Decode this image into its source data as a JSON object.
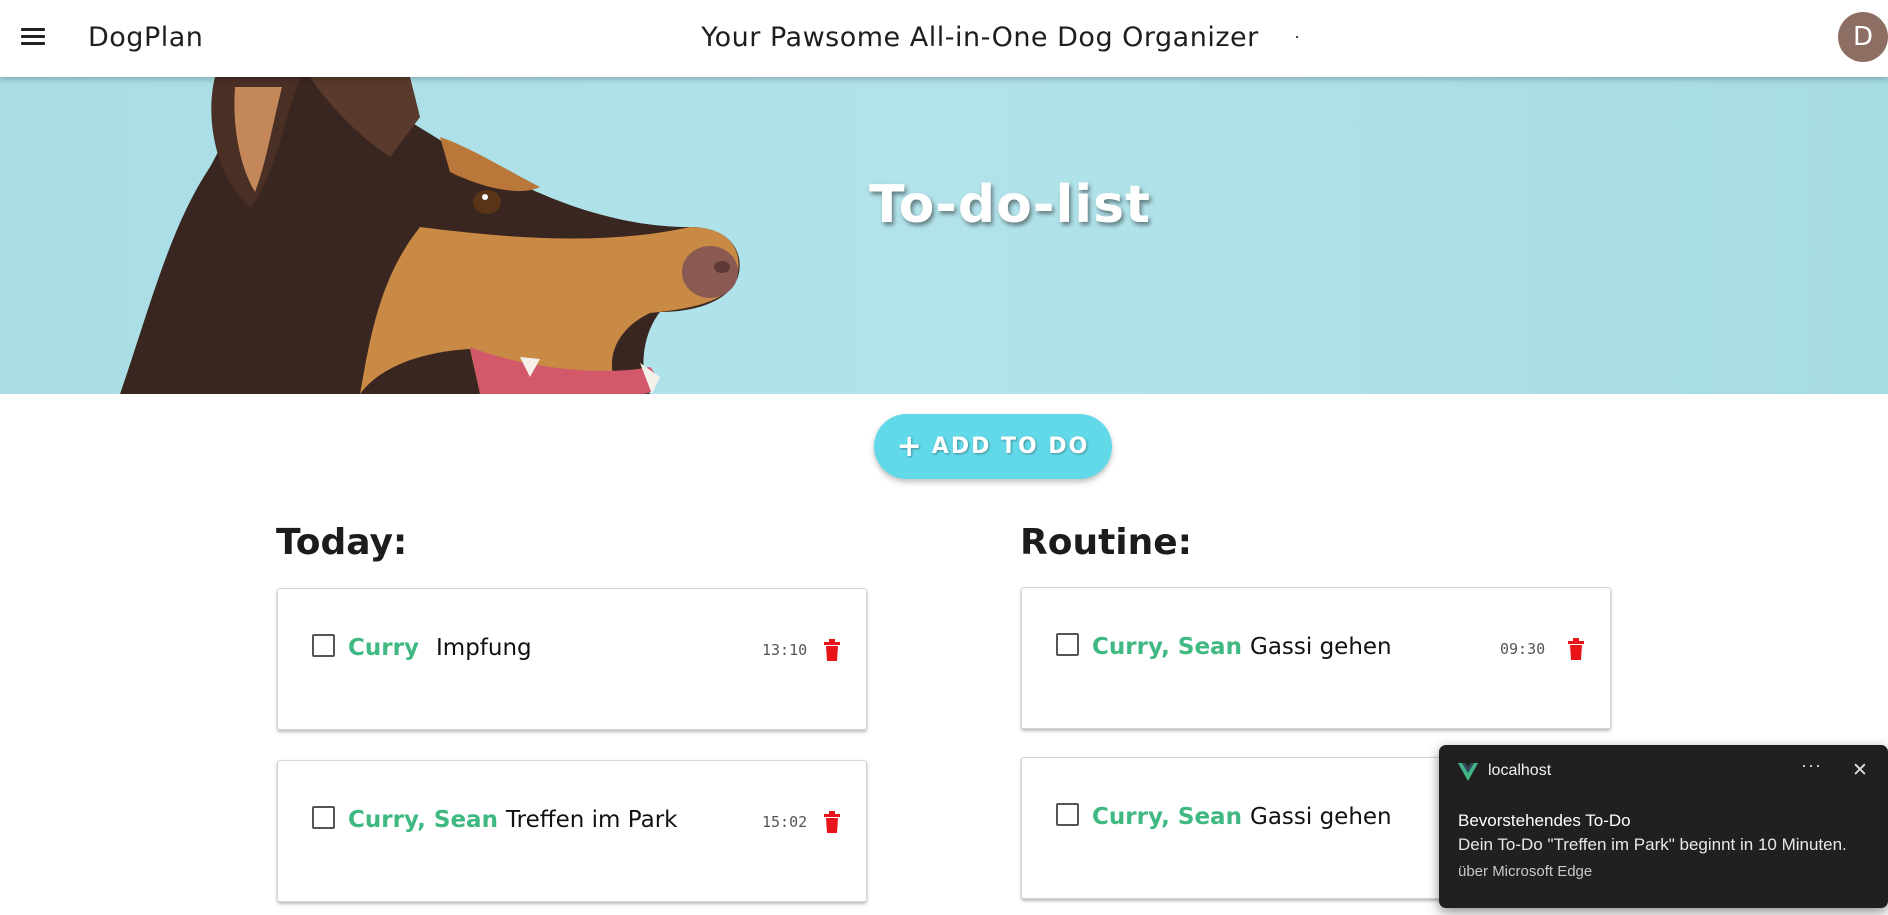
{
  "header": {
    "brand": "DogPlan",
    "tagline": "Your Pawsome All-in-One Dog Organizer",
    "avatar_letter": "D"
  },
  "hero": {
    "title": "To-do-list"
  },
  "add_button": {
    "label": "ADD TO DO"
  },
  "today": {
    "title": "Today:",
    "items": [
      {
        "dogs": "Curry",
        "task": "Impfung",
        "time": "13:10"
      },
      {
        "dogs": "Curry, Sean",
        "task": "Treffen im Park",
        "time": "15:02"
      }
    ]
  },
  "routine": {
    "title": "Routine:",
    "items": [
      {
        "dogs": "Curry, Sean",
        "task": "Gassi gehen",
        "time": "09:30"
      },
      {
        "dogs": "Curry, Sean",
        "task": "Gassi gehen",
        "time": ""
      }
    ]
  },
  "notification": {
    "source": "localhost",
    "more": "···",
    "close": "✕",
    "title": "Bevorstehendes To-Do",
    "body": "Dein To-Do \"Treffen im Park\" beginnt in 10 Minuten.",
    "via": "über Microsoft Edge"
  },
  "colors": {
    "accent_cyan": "#62d9e8",
    "dog_name_green": "#3fb882",
    "delete_red": "#e8141a",
    "hero_bg": "#afe1e8",
    "avatar_bg": "#8d6e63",
    "toast_bg": "#202020",
    "vue_green": "#41b883"
  }
}
